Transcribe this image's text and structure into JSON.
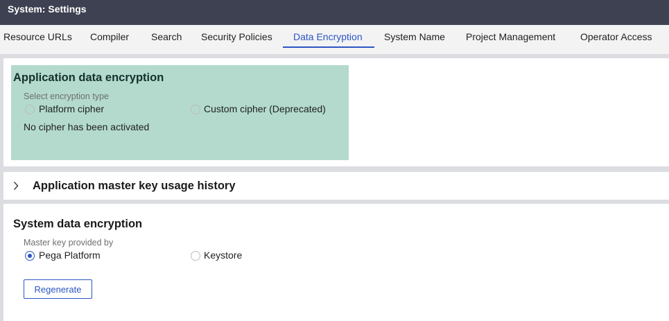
{
  "window": {
    "title": "System: Settings"
  },
  "tabs": [
    {
      "label": "Resource URLs",
      "active": false
    },
    {
      "label": "Compiler",
      "active": false
    },
    {
      "label": "Search",
      "active": false
    },
    {
      "label": "Security Policies",
      "active": false
    },
    {
      "label": "Data Encryption",
      "active": true
    },
    {
      "label": "System Name",
      "active": false
    },
    {
      "label": "Project Management",
      "active": false
    },
    {
      "label": "Operator Access",
      "active": false
    }
  ],
  "app_encryption": {
    "heading": "Application data encryption",
    "field_label": "Select encryption type",
    "options": [
      {
        "label": "Platform cipher",
        "selected": false
      },
      {
        "label": "Custom cipher (Deprecated)",
        "selected": false
      }
    ],
    "status": "No cipher has been activated"
  },
  "history": {
    "title": "Application master key usage history",
    "expanded": false,
    "toggle_icon": "chevron-right-icon"
  },
  "system_encryption": {
    "heading": "System data encryption",
    "field_label": "Master key provided by",
    "options": [
      {
        "label": "Pega Platform",
        "selected": true
      },
      {
        "label": "Keystore",
        "selected": false
      }
    ],
    "regenerate_label": "Regenerate"
  },
  "colors": {
    "title_bar": "#3e4151",
    "accent": "#2b55c4",
    "highlight": "#b3dacd"
  }
}
